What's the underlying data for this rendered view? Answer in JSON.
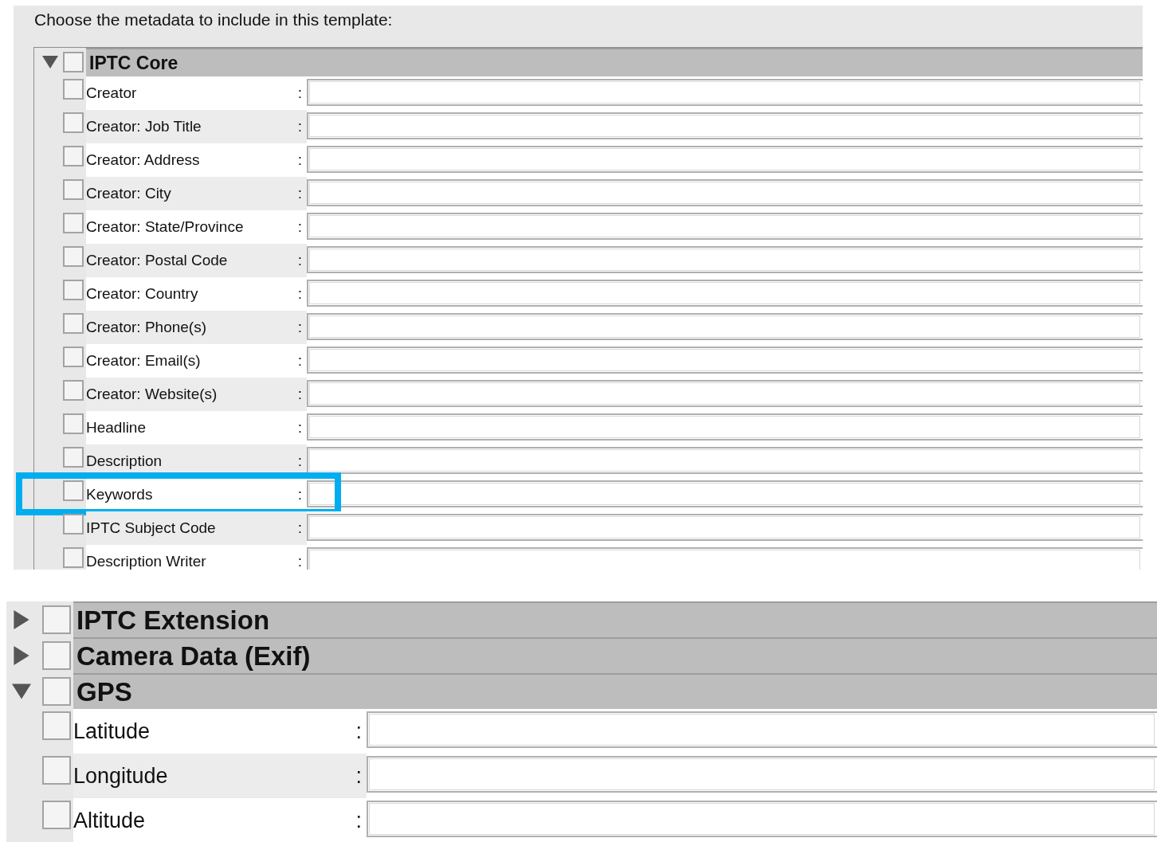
{
  "prompt": "Choose the metadata to include in this template:",
  "top_panel": {
    "groups": [
      {
        "title": "IPTC Core",
        "expanded": true,
        "checked": false,
        "fields": [
          {
            "label": "Creator",
            "separator": ":",
            "checked": false,
            "highlighted": false
          },
          {
            "label": "Creator: Job Title",
            "separator": ":",
            "checked": false,
            "highlighted": false
          },
          {
            "label": "Creator: Address",
            "separator": ":",
            "checked": false,
            "highlighted": false
          },
          {
            "label": "Creator: City",
            "separator": ":",
            "checked": false,
            "highlighted": false
          },
          {
            "label": "Creator: State/Province",
            "separator": ":",
            "checked": false,
            "highlighted": false
          },
          {
            "label": "Creator: Postal Code",
            "separator": ":",
            "checked": false,
            "highlighted": false
          },
          {
            "label": "Creator: Country",
            "separator": ":",
            "checked": false,
            "highlighted": false
          },
          {
            "label": "Creator: Phone(s)",
            "separator": ":",
            "checked": false,
            "highlighted": false
          },
          {
            "label": "Creator: Email(s)",
            "separator": ":",
            "checked": false,
            "highlighted": false
          },
          {
            "label": "Creator: Website(s)",
            "separator": ":",
            "checked": false,
            "highlighted": false
          },
          {
            "label": "Headline",
            "separator": ":",
            "checked": false,
            "highlighted": false
          },
          {
            "label": "Description",
            "separator": ":",
            "checked": false,
            "highlighted": false
          },
          {
            "label": "Keywords",
            "separator": ":",
            "checked": false,
            "highlighted": true
          },
          {
            "label": "IPTC Subject Code",
            "separator": ":",
            "checked": false,
            "highlighted": false
          },
          {
            "label": "Description Writer",
            "separator": ":",
            "checked": false,
            "highlighted": false
          }
        ]
      }
    ]
  },
  "bottom_panel": {
    "groups": [
      {
        "title": "IPTC Extension",
        "expanded": false,
        "checked": false
      },
      {
        "title": "Camera Data (Exif)",
        "expanded": false,
        "checked": false
      },
      {
        "title": "GPS",
        "expanded": true,
        "checked": false,
        "fields": [
          {
            "label": "Latitude",
            "separator": ":",
            "checked": false,
            "highlighted": false
          },
          {
            "label": "Longitude",
            "separator": ":",
            "checked": false,
            "highlighted": false
          },
          {
            "label": "Altitude",
            "separator": ":",
            "checked": false,
            "highlighted": false
          }
        ]
      }
    ]
  }
}
